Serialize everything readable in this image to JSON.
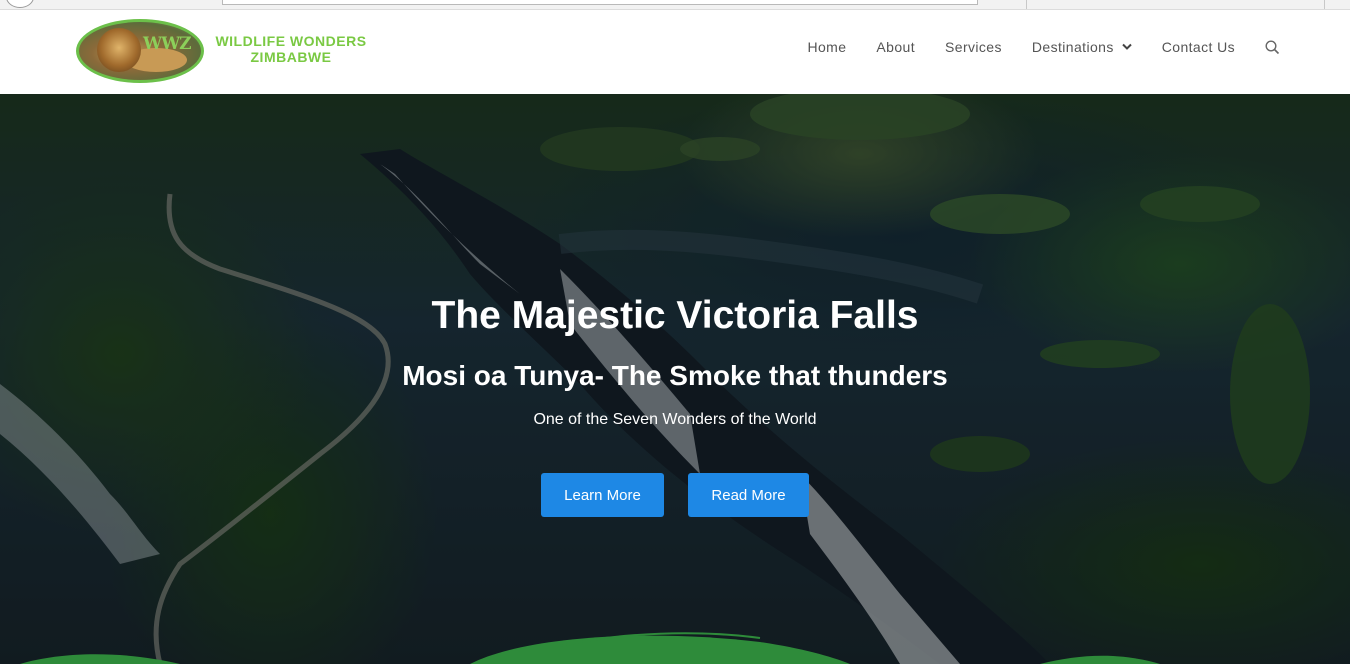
{
  "brand": {
    "logo_mark": "WWZ",
    "name_line1": "WILDLIFE WONDERS",
    "name_line2": "ZIMBABWE",
    "accent_color": "#7ac943"
  },
  "nav": {
    "items": [
      {
        "label": "Home"
      },
      {
        "label": "About"
      },
      {
        "label": "Services"
      },
      {
        "label": "Destinations",
        "has_dropdown": true
      },
      {
        "label": "Contact Us"
      }
    ],
    "search_icon": "search-icon"
  },
  "hero": {
    "title": "The Majestic Victoria Falls",
    "subtitle": "Mosi oa Tunya- The Smoke that thunders",
    "tagline": "One of the Seven Wonders of the World",
    "buttons": {
      "learn_more": "Learn More",
      "read_more": "Read More"
    },
    "button_color": "#1e88e5",
    "wave_color": "#2e8b3a"
  }
}
